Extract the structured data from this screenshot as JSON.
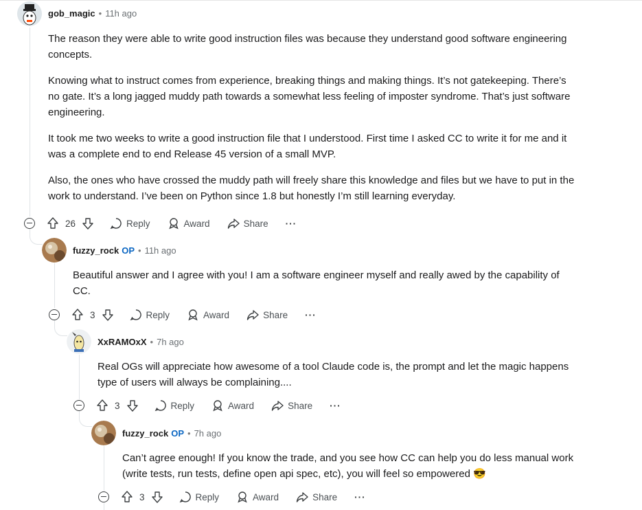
{
  "comments": [
    {
      "username": "gob_magic",
      "op": "",
      "time": "11h ago",
      "paragraphs": [
        "The reason they were able to write good instruction files was because they understand good software engineering concepts.",
        "Knowing what to instruct comes from experience, breaking things and making things. It’s not gatekeeping. There’s no gate. It’s a long jagged muddy path towards a somewhat less feeling of imposter syndrome. That’s just software engineering.",
        "It took me two weeks to write a good instruction file that I understood. First time I asked CC to write it for me and it was a complete end to end Release 45 version of a small MVP.",
        "Also, the ones who have crossed the muddy path will freely share this knowledge and files but we have to put in the work to understand. I’ve been on Python since 1.8 but honestly I’m still learning everyday."
      ],
      "votes": "26",
      "reply_label": "Reply",
      "award_label": "Award",
      "share_label": "Share",
      "more_label": "···"
    },
    {
      "username": "fuzzy_rock",
      "op": "OP",
      "time": "11h ago",
      "paragraphs": [
        "Beautiful answer and I agree with you! I am a software engineer myself and really awed by the capability of CC."
      ],
      "votes": "3",
      "reply_label": "Reply",
      "award_label": "Award",
      "share_label": "Share",
      "more_label": "···"
    },
    {
      "username": "XxRAMOxX",
      "op": "",
      "time": "7h ago",
      "paragraphs": [
        "Real OGs will appreciate how awesome of a tool Claude code is, the prompt and let the magic happens type of users will always be complaining...."
      ],
      "votes": "3",
      "reply_label": "Reply",
      "award_label": "Award",
      "share_label": "Share",
      "more_label": "···"
    },
    {
      "username": "fuzzy_rock",
      "op": "OP",
      "time": "7h ago",
      "paragraphs": [
        "Can’t agree enough! If you know the trade, and you see how CC can help you do less manual work (write tests, run tests, define open api spec, etc), you will feel so empowered 😎"
      ],
      "votes": "3",
      "reply_label": "Reply",
      "award_label": "Award",
      "share_label": "Share",
      "more_label": "···"
    }
  ],
  "colors": {
    "op": "#0a66c2",
    "thread": "#dfe3e6"
  },
  "icons": [
    "collapse-icon",
    "upvote-icon",
    "downvote-icon",
    "reply-icon",
    "award-icon",
    "share-icon",
    "more-icon"
  ]
}
